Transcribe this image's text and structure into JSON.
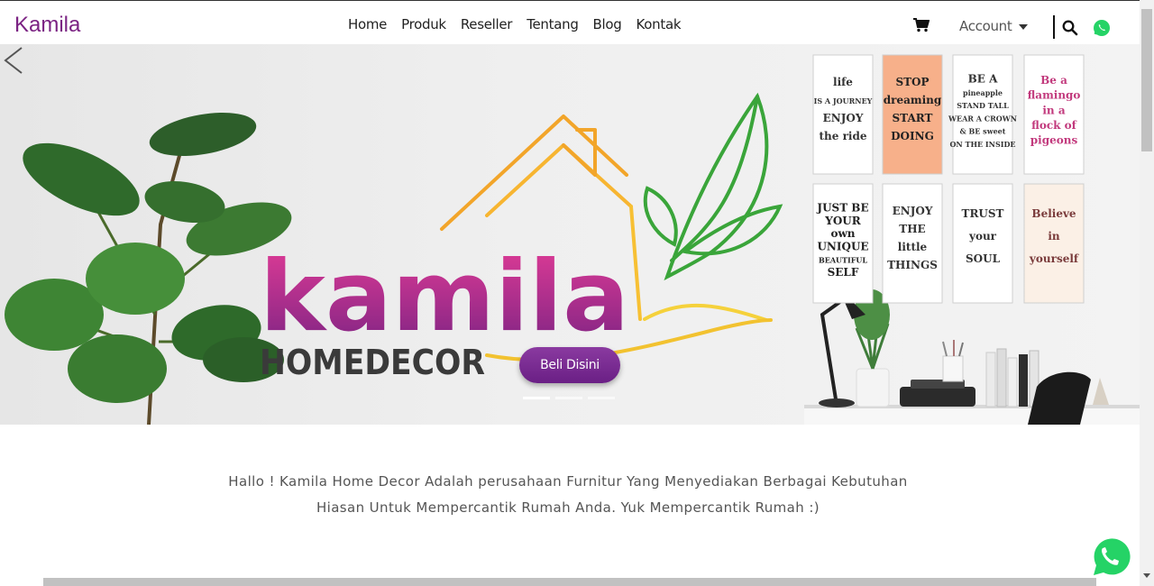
{
  "brand": "Kamila",
  "nav": {
    "links": [
      "Home",
      "Produk",
      "Reseller",
      "Tentang",
      "Blog",
      "Kontak"
    ],
    "account_label": "Account",
    "icons": [
      "cart-icon",
      "search-icon",
      "whatsapp-icon"
    ]
  },
  "hero": {
    "logo_main": "kamila",
    "logo_sub": "HOMEDECOR",
    "cta_label": "Beli Disini",
    "posters": [
      [
        "life",
        "IS A JOURNEY",
        "ENJOY",
        "the ride"
      ],
      [
        "STOP",
        "dreaming",
        "START",
        "DOING"
      ],
      [
        "BE A",
        "pineapple",
        "STAND TALL",
        "WEAR A CROWN",
        "& BE sweet",
        "ON THE INSIDE"
      ],
      [
        "Be a",
        "flamingo",
        "in a",
        "flock of",
        "pigeons"
      ],
      [
        "JUST BE",
        "YOUR",
        "own",
        "UNIQUE",
        "BEAUTIFUL",
        "SELF"
      ],
      [
        "ENJOY",
        "THE",
        "little",
        "THINGS"
      ],
      [
        "TRUST",
        "your",
        "SOUL"
      ],
      [
        "Believe",
        "in",
        "yourself"
      ]
    ],
    "slide_count": 3,
    "active_slide": 1
  },
  "intro_text": "Hallo ! Kamila Home Decor Adalah perusahaan Furnitur Yang Menyediakan Berbagai Kebutuhan Hiasan Untuk Mempercantik Rumah Anda. Yuk Mempercantik Rumah :)",
  "colors": {
    "brand": "#7b2383",
    "logo_pink": "#c2298a",
    "cta": "#7a2c93",
    "leaf_green": "#3aa53a",
    "house_orange": "#f2a52a",
    "whatsapp": "#25d366"
  }
}
